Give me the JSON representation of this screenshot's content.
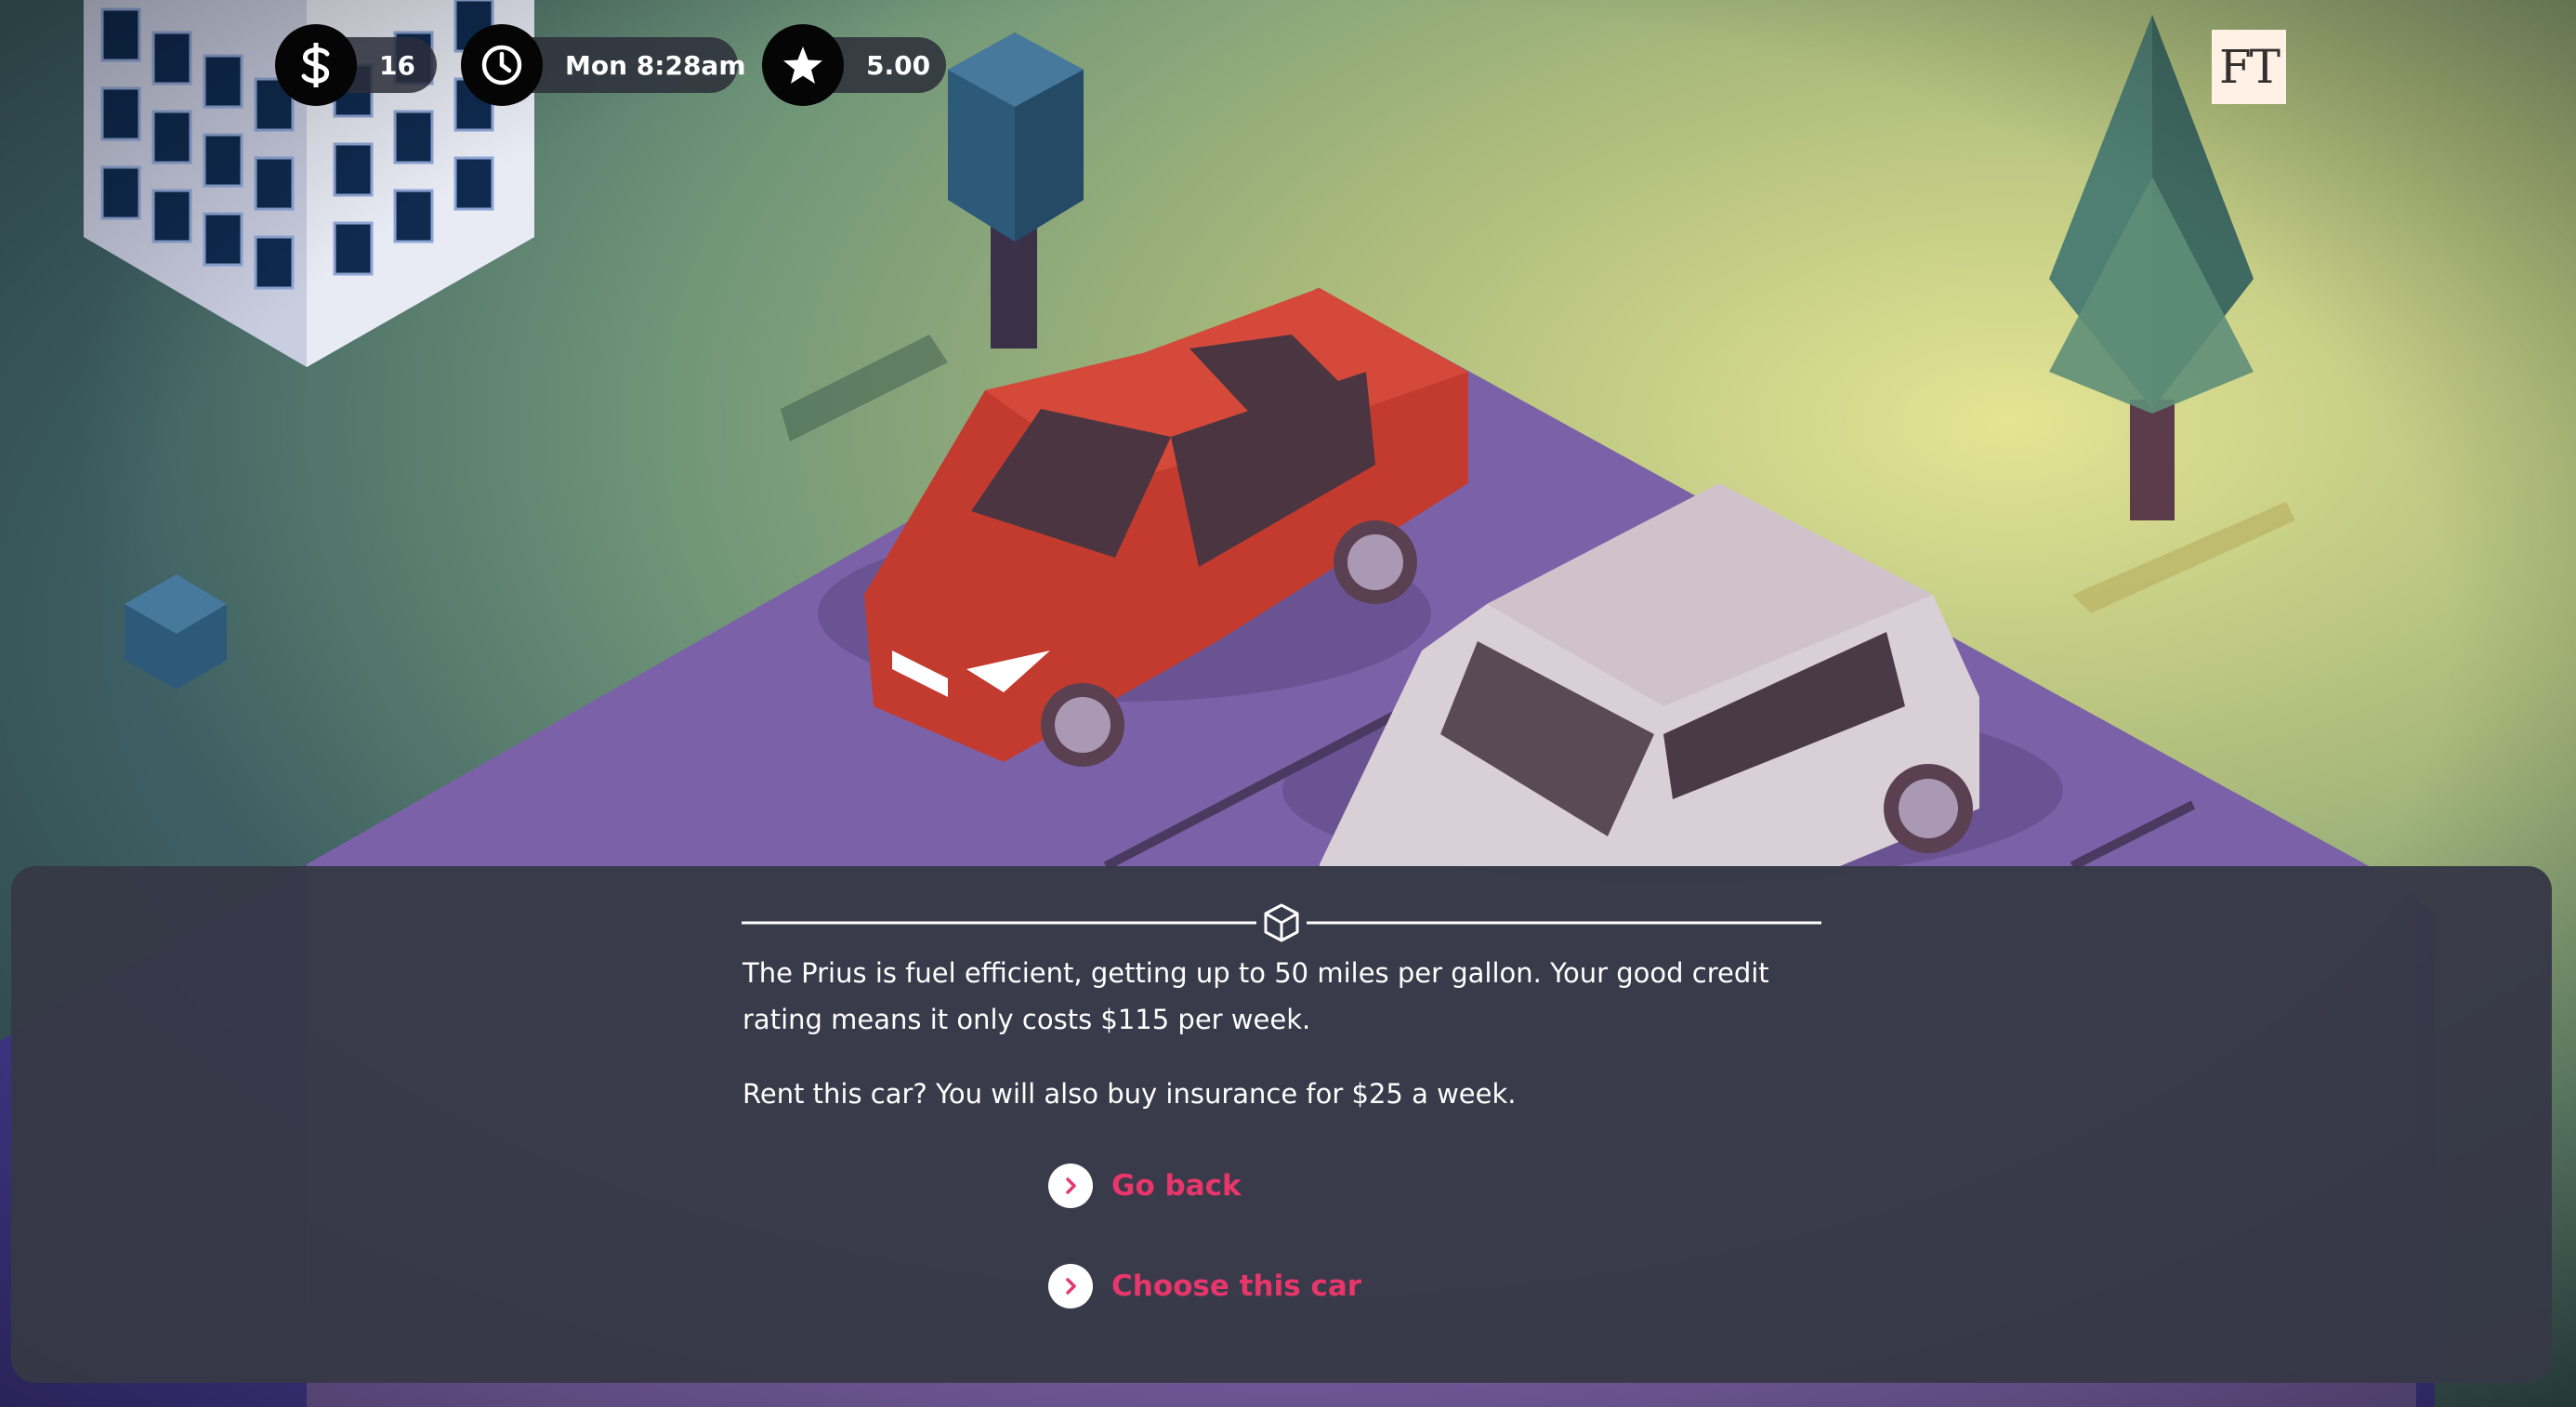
{
  "hud": {
    "money": {
      "icon": "dollar-icon",
      "value": "16"
    },
    "time": {
      "icon": "clock-icon",
      "value": "Mon 8:28am"
    },
    "rating": {
      "icon": "star-icon",
      "value": "5.00"
    }
  },
  "logo": {
    "text": "FT"
  },
  "dialog": {
    "divider_icon": "cube-icon",
    "description": "The Prius is fuel efficient, getting up to 50 miles per gallon. Your good credit rating means it only costs $115 per week.",
    "prompt": "Rent this car? You will also buy insurance for $25 a week.",
    "choices": [
      {
        "label": "Go back",
        "icon": "chevron-right-icon"
      },
      {
        "label": "Choose this car",
        "icon": "chevron-right-icon"
      }
    ]
  },
  "colors": {
    "choice_text": "#e8366b",
    "dialog_bg": "#363846",
    "road": "#7b5ea8",
    "red_car": "#c23b2e",
    "white_car": "#d9cfd6"
  }
}
